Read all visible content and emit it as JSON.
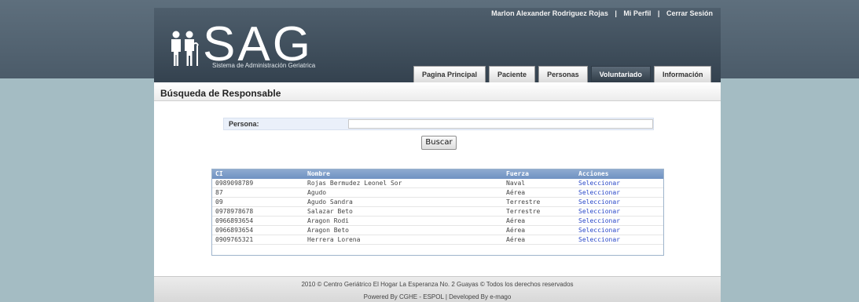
{
  "header": {
    "user_name": "Marlon Alexander Rodriguez Rojas",
    "profile_link": "Mi Perfil",
    "logout_link": "Cerrar Sesión",
    "separator": "|"
  },
  "logo": {
    "text": "SAG",
    "subtitle": "Sistema de Administración Geriatrica"
  },
  "tabs": [
    {
      "label": "Pagina Principal",
      "active": false
    },
    {
      "label": "Paciente",
      "active": false
    },
    {
      "label": "Personas",
      "active": false
    },
    {
      "label": "Voluntariado",
      "active": true
    },
    {
      "label": "Información",
      "active": false
    }
  ],
  "main": {
    "title": "Búsqueda de Responsable",
    "persona_label": "Persona:",
    "persona_value": "",
    "search_button": "Buscar"
  },
  "table": {
    "headers": [
      "CI",
      "Nombre",
      "Fuerza",
      "Acciones"
    ],
    "rows": [
      [
        "0989098789",
        "Rojas Bermudez Leonel Sor",
        "Naval",
        "Seleccionar"
      ],
      [
        "87",
        "Agudo",
        "Aérea",
        "Seleccionar"
      ],
      [
        "09",
        "Agudo Sandra",
        "Terrestre",
        "Seleccionar"
      ],
      [
        "0978978678",
        "Salazar Beto",
        "Terrestre",
        "Seleccionar"
      ],
      [
        "0966893654",
        "Aragon Rodi",
        "Aérea",
        "Seleccionar"
      ],
      [
        "0966893654",
        "Aragon Beto",
        "Aérea",
        "Seleccionar"
      ],
      [
        "0909765321",
        "Herrera Lorena",
        "Aérea",
        "Seleccionar"
      ]
    ]
  },
  "footer": {
    "line1": "2010 © Centro Geriátrico El Hogar La Esperanza No. 2 Guayas © Todos los derechos reservados",
    "line2": "Powered By CGHE - ESPOL | Developed By e-mago"
  },
  "colors": {
    "header_bg": "#3f4d5a",
    "page_bg": "#a4bcc3",
    "table_header": "#7a9bc8",
    "link": "#2a48c8"
  },
  "icons": [
    "elderly-figures-logo-icon"
  ]
}
